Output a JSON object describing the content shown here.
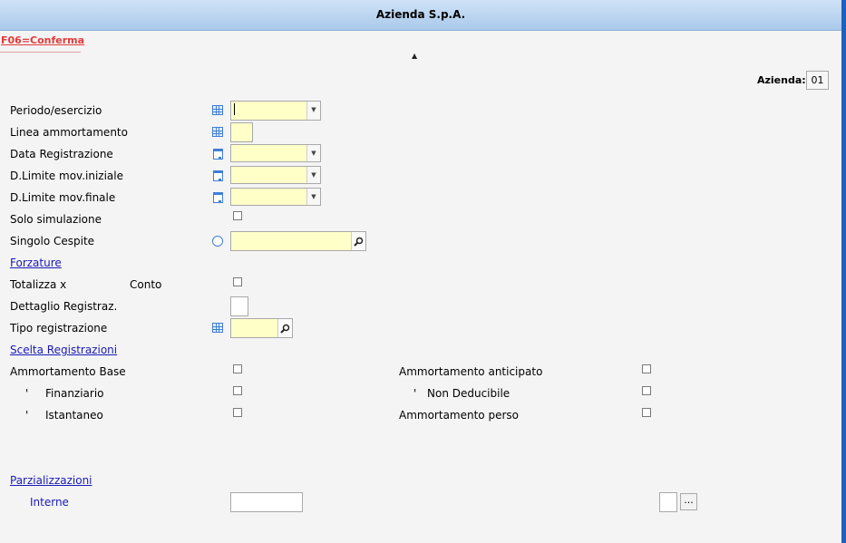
{
  "window": {
    "title": "Azienda S.p.A."
  },
  "toolbar": {
    "confirm_label": "F06=Conferma",
    "collapse_glyph": "▲"
  },
  "azienda": {
    "label": "Azienda:",
    "value": "01"
  },
  "form": {
    "periodo_label": "Periodo/esercizio",
    "linea_label": "Linea ammortamento",
    "data_reg_label": "Data Registrazione",
    "dlimite_iniziale_label": "D.Limite mov.iniziale",
    "dlimite_finale_label": "D.Limite mov.finale",
    "solo_simulazione_label": "Solo simulazione",
    "singolo_cespite_label": "Singolo Cespite"
  },
  "forzature": {
    "section_label": "Forzature",
    "totalizza_label": "Totalizza x",
    "conto_label": "Conto",
    "dettaglio_label": "Dettaglio Registraz.",
    "tipo_reg_label": "Tipo registrazione"
  },
  "scelta": {
    "section_label": "Scelta Registrazioni",
    "ammortamento_base_label": "Ammortamento Base",
    "finanziario_tick": "'",
    "finanziario_label": "Finanziario",
    "istantaneo_tick": "'",
    "istantaneo_label": "Istantaneo",
    "ammortamento_anticipato_label": "Ammortamento anticipato",
    "non_deducibile_tick": "'",
    "non_deducibile_label": "Non Deducibile",
    "ammortamento_perso_label": "Ammortamento perso"
  },
  "parzializzazioni": {
    "section_label": "Parzializzazioni",
    "interne_label": "Interne",
    "more_button_label": "..."
  },
  "icons": {
    "grid": "table-icon",
    "calendar": "calendar-icon",
    "radio": "radio-icon",
    "search": "search-icon"
  },
  "colors": {
    "field_background": "#ffffc8",
    "confirm_text": "#e23a3a",
    "link_text": "#1a1ab8",
    "titlebar": "#b8d4f0",
    "icon_blue": "#3f7ed8"
  }
}
